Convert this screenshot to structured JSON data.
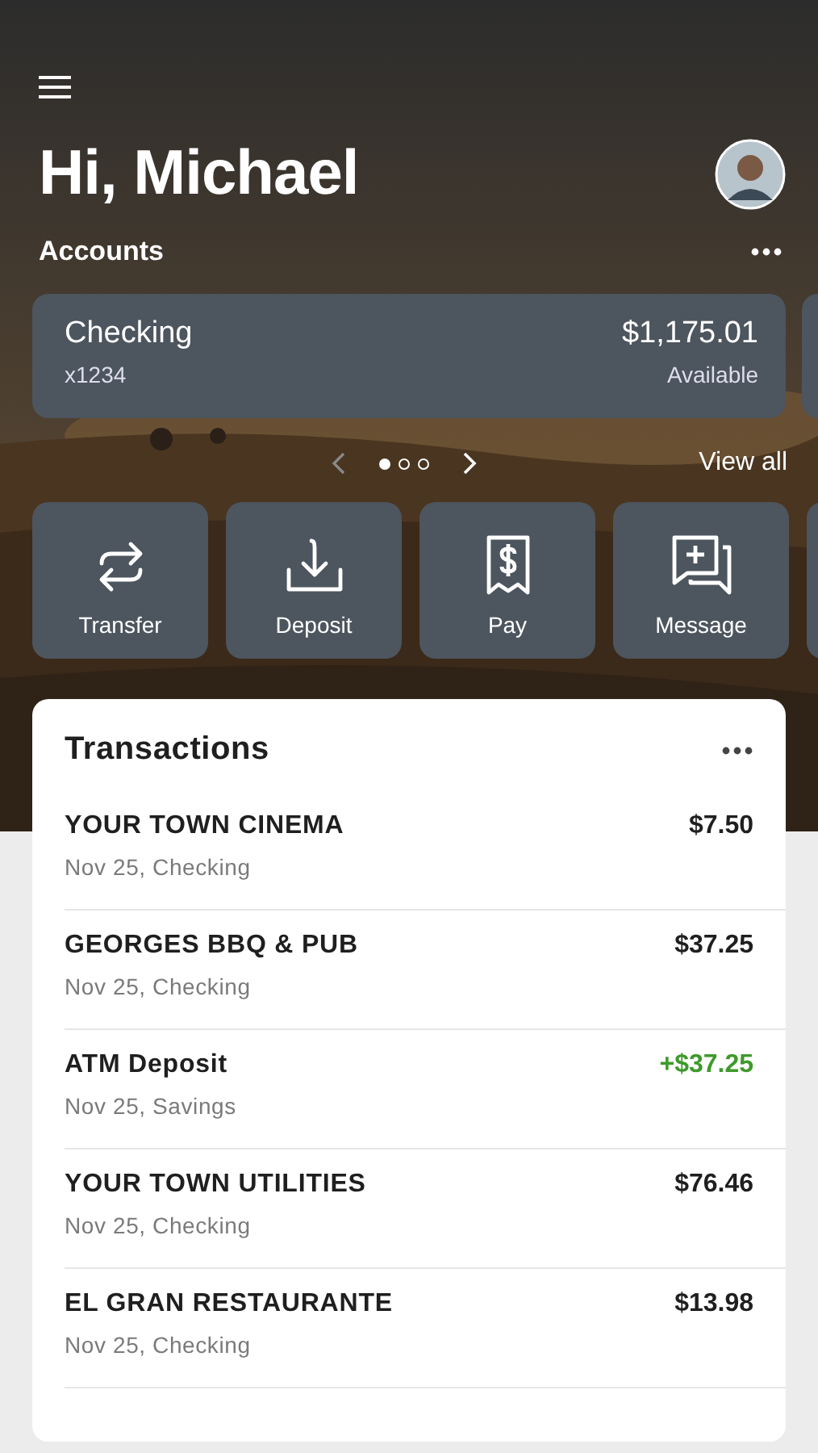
{
  "greeting": "Hi, Michael",
  "accounts": {
    "title": "Accounts",
    "cards": [
      {
        "name": "Checking",
        "number": "x1234",
        "balance": "$1,175.01",
        "balance_label": "Available"
      }
    ],
    "pager": [
      {
        "selected": true
      },
      {
        "selected": false
      },
      {
        "selected": false
      }
    ],
    "view_all": "View all"
  },
  "actions": [
    {
      "label": "Transfer",
      "kind": "transfer"
    },
    {
      "label": "Deposit",
      "kind": "deposit"
    },
    {
      "label": "Pay",
      "kind": "pay"
    },
    {
      "label": "Message",
      "kind": "message"
    }
  ],
  "transactions": {
    "title": "Transactions",
    "rows": [
      {
        "name": "YOUR TOWN CINEMA",
        "detail": "Nov 25, Checking",
        "amount": "$7.50",
        "kind": "debit"
      },
      {
        "name": "GEORGES BBQ & PUB",
        "detail": "Nov 25, Checking",
        "amount": "$37.25",
        "kind": "debit"
      },
      {
        "name": "ATM Deposit",
        "detail": "Nov 25, Savings",
        "amount": "+$37.25",
        "kind": "credit"
      },
      {
        "name": "YOUR TOWN UTILITIES",
        "detail": "Nov 25, Checking",
        "amount": "$76.46",
        "kind": "debit"
      },
      {
        "name": "EL GRAN RESTAURANTE",
        "detail": "Nov 25, Checking",
        "amount": "$13.98",
        "kind": "debit"
      }
    ]
  }
}
